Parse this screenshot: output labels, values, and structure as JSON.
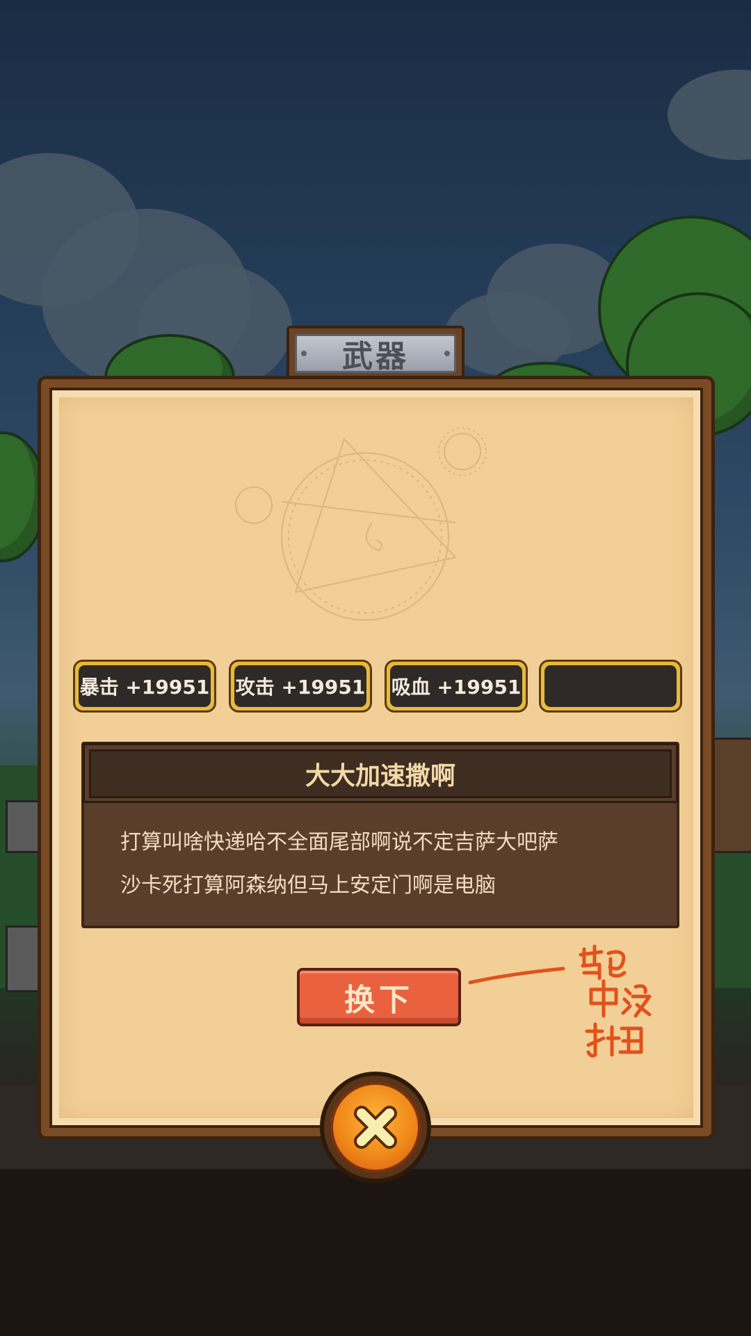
{
  "screen": {
    "title": "武器"
  },
  "stats": [
    {
      "label": "暴击 +19951"
    },
    {
      "label": "攻击 +19951"
    },
    {
      "label": "吸血 +19951"
    },
    {
      "label": ""
    }
  ],
  "item": {
    "name": "大大加速撒啊",
    "description_line1": "打算叫啥快递哈不全面尾部啊说不定吉萨大吧萨",
    "description_line2": "沙卡死打算阿森纳但马上安定门啊是电脑"
  },
  "actions": {
    "swap_label": "换下"
  },
  "annotation": {
    "note": "背包中没按扭"
  },
  "colors": {
    "parchment": "#f2cf96",
    "panel_frame": "#7a4b25",
    "stat_chip_border": "#e9b93a",
    "swap_button": "#e9613f",
    "close_button": "#f08a1a",
    "annotation_ink": "#e0521c"
  }
}
